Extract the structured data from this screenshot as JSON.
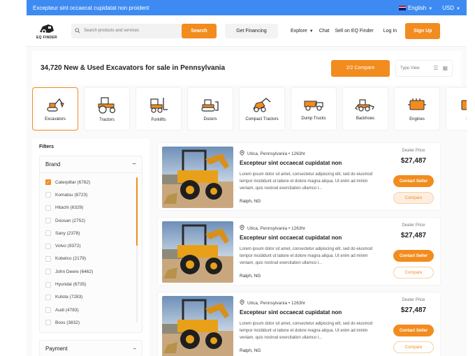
{
  "topbar": {
    "message": "Excepteur sint occaecat cupidatat non proident",
    "language": "English",
    "currency": "USD"
  },
  "header": {
    "logo_text": "EQ FINDER",
    "search_placeholder": "Search products and services",
    "search_button": "Search",
    "financing": "Get Financing",
    "nav_explore": "Explore",
    "nav_chat": "Chat",
    "nav_sell": "Sell on EQ Finder",
    "login": "Log In",
    "signup": "Sign Up"
  },
  "titlebar": {
    "title": "34,720 New & Used Excavators for sale in Pennsylvania",
    "compare_button": "2/2 Compare",
    "view_label": "Type View"
  },
  "categories": [
    {
      "label": "Excavators",
      "icon": "excavator-icon",
      "active": true
    },
    {
      "label": "Tractors",
      "icon": "tractor-icon"
    },
    {
      "label": "Forklifts",
      "icon": "forklift-icon"
    },
    {
      "label": "Dozers",
      "icon": "dozer-icon"
    },
    {
      "label": "Compact Tractors",
      "icon": "compact-tractor-icon"
    },
    {
      "label": "Dump Trucks",
      "icon": "dump-truck-icon"
    },
    {
      "label": "Backhoes",
      "icon": "backhoe-icon"
    },
    {
      "label": "Engines",
      "icon": "engine-icon"
    },
    {
      "label": "En",
      "icon": "engine-icon"
    }
  ],
  "filters": {
    "title": "Filters",
    "brand_header": "Brand",
    "brands": [
      {
        "label": "Caterpillar (6782)",
        "checked": true
      },
      {
        "label": "Komatsu (8723)"
      },
      {
        "label": "Hitachi (6329)"
      },
      {
        "label": "Doosan (2752)"
      },
      {
        "label": "Sany (2378)"
      },
      {
        "label": "Volvo (9372)"
      },
      {
        "label": "Kobelco (2179)"
      },
      {
        "label": "John Deere (6462)"
      },
      {
        "label": "Hyundai (6735)"
      },
      {
        "label": "Kutota (7283)"
      },
      {
        "label": "Audi (4783)"
      },
      {
        "label": "Boss (3832)"
      }
    ],
    "payment_header": "Payment"
  },
  "listings": [
    {
      "location": "Utica, Pennsylvania • 1263hr",
      "title": "Excepteur sint occaecat cupidatat non",
      "description": "Lorem ipsum dolor sit amet, consectetur adipiscing elit, sed do eiusmod tempor incididunt ut labore et dolore magna aliqua. Ut enim ad minim veniam, quis nostrud exercitation ullamco l...",
      "seller": "Ralph, NG",
      "price_label": "Dealer Price",
      "price": "$27,487",
      "contact": "Contact Seller",
      "compare": "Compare"
    },
    {
      "location": "Utica, Pennsylvania • 1263hr",
      "title": "Excepteur sint occaecat cupidatat non",
      "description": "Lorem ipsum dolor sit amet, consectetur adipiscing elit, sed do eiusmod tempor incididunt ut labore et dolore magna aliqua. Ut enim ad minim veniam, quis nostrud exercitation ullamco l...",
      "seller": "Ralph, NG",
      "price_label": "Dealer Price",
      "price": "$27,487",
      "contact": "Contact Seller",
      "compare": "Compare"
    },
    {
      "location": "Utica, Pennsylvania • 1263hr",
      "title": "Excepteur sint occaecat cupidatat non",
      "description": "Lorem ipsum dolor sit amet, consectetur adipiscing elit, sed do eiusmod tempor incididunt ut labore et dolore magna aliqua. Ut enim ad minim veniam, quis nostrud exercitation ullamco l...",
      "seller": "Ralph, NG",
      "price_label": "Dealer Price",
      "price": "$27,487",
      "contact": "Contact Seller",
      "compare": "Compare"
    }
  ],
  "colors": {
    "accent": "#f28c1e",
    "topbar": "#3d8bf2"
  }
}
